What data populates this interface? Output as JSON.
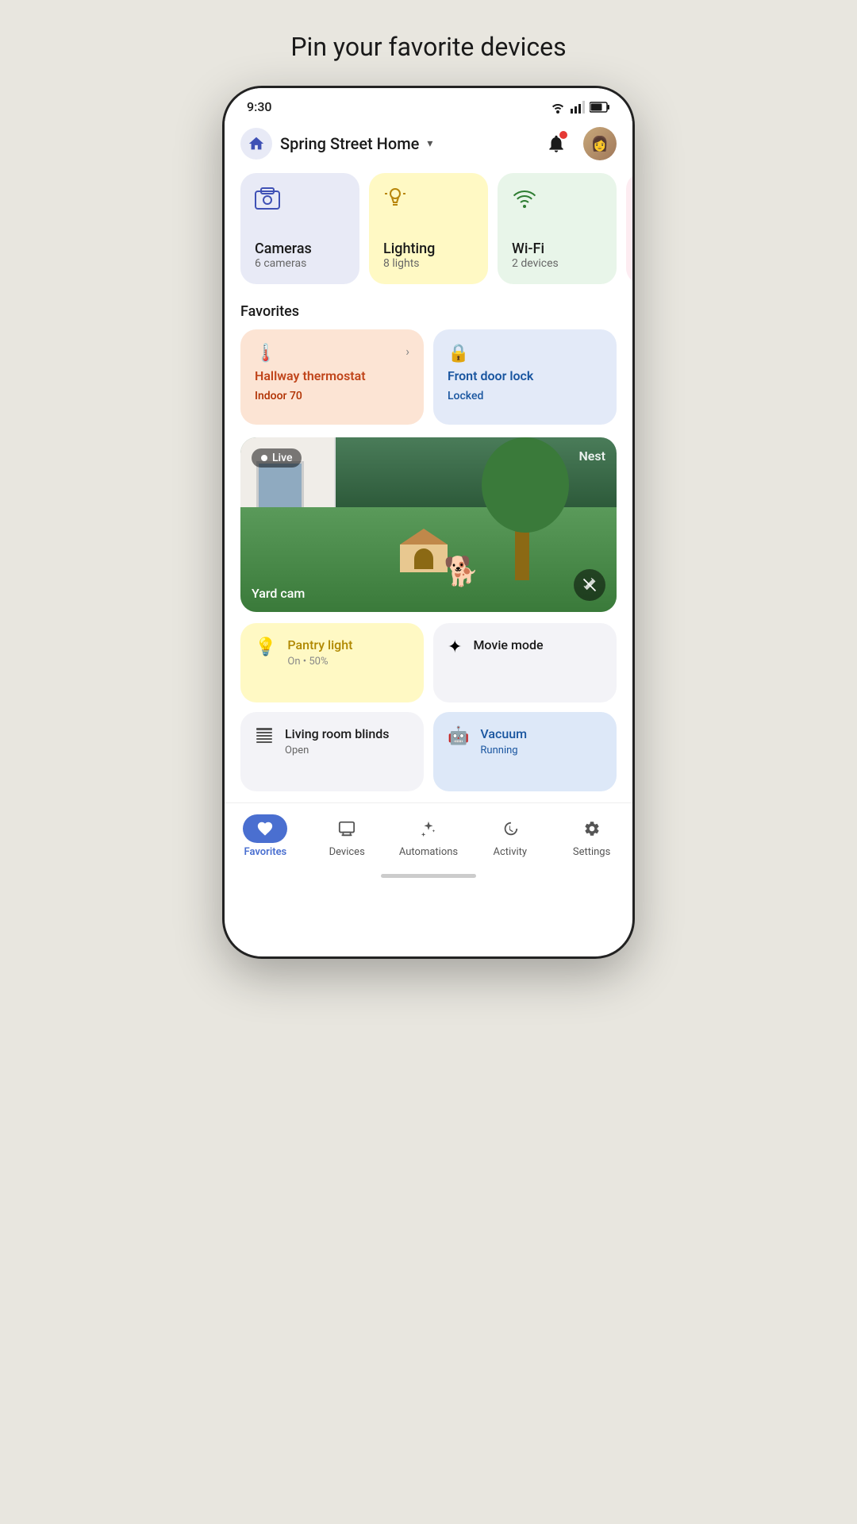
{
  "page": {
    "title": "Pin your favorite devices"
  },
  "status_bar": {
    "time": "9:30"
  },
  "header": {
    "home_name": "Spring Street Home",
    "chevron": "▾"
  },
  "categories": [
    {
      "id": "cameras",
      "name": "Cameras",
      "count": "6 cameras",
      "color": "cameras"
    },
    {
      "id": "lighting",
      "name": "Lighting",
      "count": "8 lights",
      "color": "lighting"
    },
    {
      "id": "wifi",
      "name": "Wi-Fi",
      "count": "2 devices",
      "color": "wifi"
    }
  ],
  "favorites_label": "Favorites",
  "favorites": [
    {
      "id": "thermostat",
      "name": "Hallway thermostat",
      "status": "Indoor 70",
      "type": "thermostat"
    },
    {
      "id": "door-lock",
      "name": "Front door lock",
      "status": "Locked",
      "type": "door-lock"
    }
  ],
  "camera": {
    "live_label": "Live",
    "brand": "Nest",
    "name": "Yard cam"
  },
  "bottom_cards": [
    {
      "id": "pantry",
      "name": "Pantry light",
      "status": "On • 50%",
      "type": "pantry"
    },
    {
      "id": "movie",
      "name": "Movie mode",
      "status": "",
      "type": "movie"
    },
    {
      "id": "blinds",
      "name": "Living room blinds",
      "status": "Open",
      "type": "blinds"
    },
    {
      "id": "vacuum",
      "name": "Vacuum",
      "status": "Running",
      "type": "vacuum"
    }
  ],
  "nav": [
    {
      "id": "favorites",
      "label": "Favorites",
      "active": true
    },
    {
      "id": "devices",
      "label": "Devices",
      "active": false
    },
    {
      "id": "automations",
      "label": "Automations",
      "active": false
    },
    {
      "id": "activity",
      "label": "Activity",
      "active": false
    },
    {
      "id": "settings",
      "label": "Settings",
      "active": false
    }
  ]
}
